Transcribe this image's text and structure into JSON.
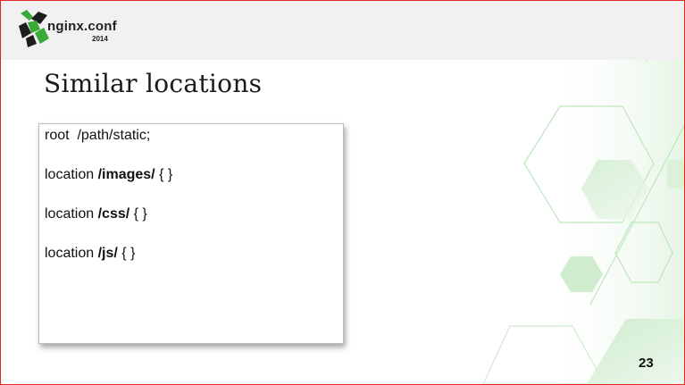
{
  "logo": {
    "name": "nginx.conf",
    "year": "2014"
  },
  "slide": {
    "title": "Similar locations",
    "page_number": "23"
  },
  "code": {
    "root_line": "root  /path/static;",
    "locations": [
      {
        "keyword": "location ",
        "path": "/images/",
        "block": " { }"
      },
      {
        "keyword": "location ",
        "path": "/css/",
        "block": " { }"
      },
      {
        "keyword": "location ",
        "path": "/js/",
        "block": " { }"
      }
    ]
  },
  "colors": {
    "border": "#e2262a",
    "header_bg": "#f1f1f1",
    "logo_green": "#3aa935",
    "logo_dark": "#1d1d1b",
    "decor_green": "#cdeccc"
  },
  "icons": {
    "logo_mark": "nginx-x-hexagon-icon"
  }
}
